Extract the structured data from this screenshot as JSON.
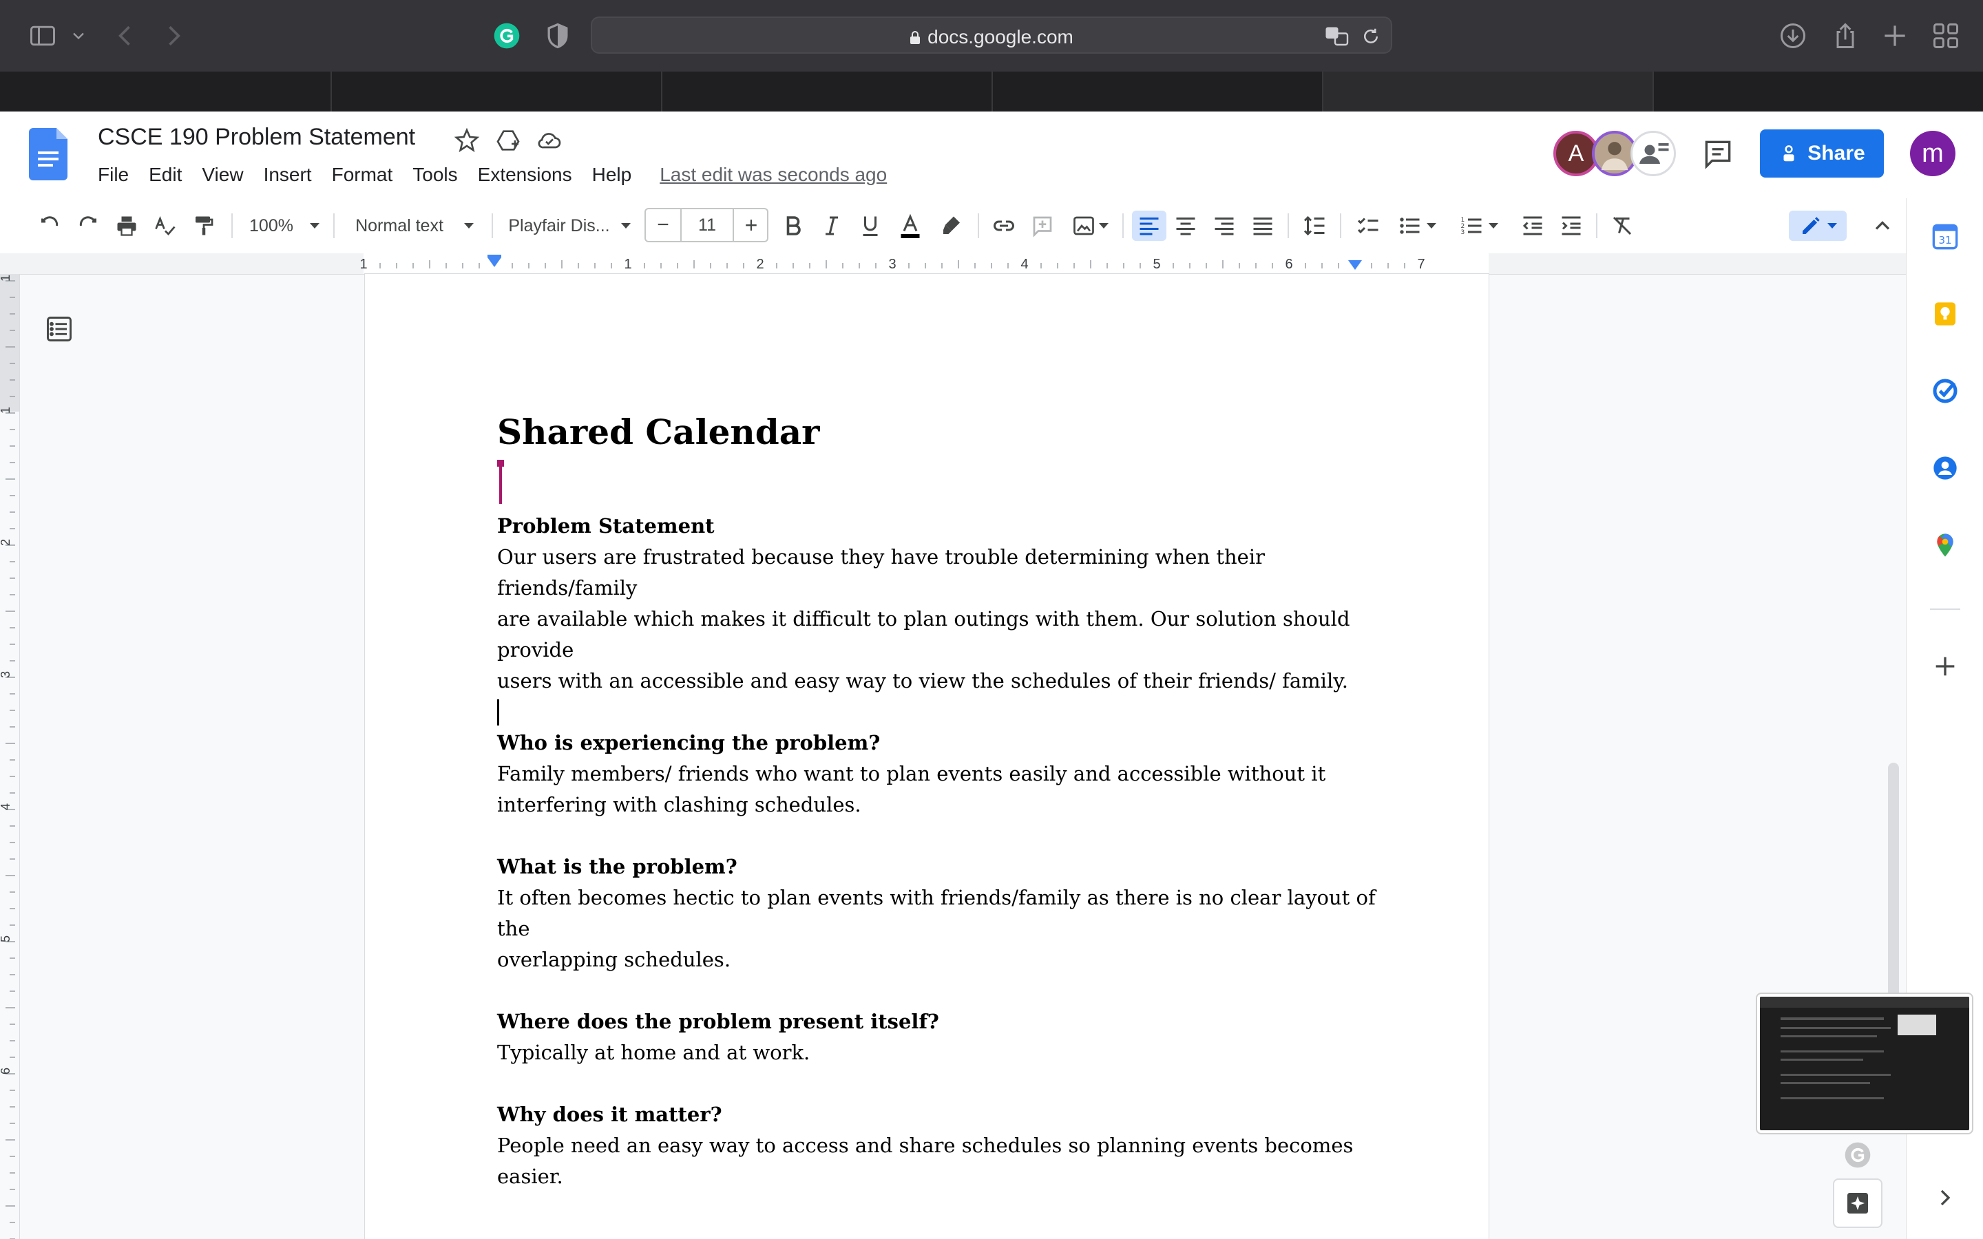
{
  "browser": {
    "url": "docs.google.com"
  },
  "doc": {
    "title": "CSCE 190 Problem Statement",
    "last_edit": "Last edit was seconds ago",
    "menu": [
      "File",
      "Edit",
      "View",
      "Insert",
      "Format",
      "Tools",
      "Extensions",
      "Help"
    ]
  },
  "header": {
    "share_label": "Share",
    "collaborator_initial": "A",
    "user_initial": "m"
  },
  "toolbar": {
    "zoom": "100%",
    "style": "Normal text",
    "font": "Playfair Dis...",
    "font_size": "11"
  },
  "ruler": {
    "labels": [
      "1",
      "1",
      "2",
      "3",
      "4",
      "5",
      "6",
      "7"
    ],
    "vlabels": [
      "1",
      "1",
      "2",
      "3",
      "4",
      "5",
      "6"
    ]
  },
  "content": {
    "heading": "Shared Calendar",
    "sections": [
      {
        "title": "Problem Statement",
        "lines": [
          "Our users are frustrated because they have trouble determining when their friends/family",
          "are available which makes it difficult to plan outings with them. Our solution should provide",
          "users with an accessible and easy way to view the schedules of their friends/ family."
        ]
      },
      {
        "title": "Who is experiencing the problem?",
        "lines": [
          "Family members/ friends who want to plan events easily and accessible without it",
          "interfering with clashing schedules."
        ]
      },
      {
        "title": "What is the problem?",
        "lines": [
          "It often becomes hectic to plan events with friends/family as there is no clear layout of the",
          "overlapping schedules."
        ]
      },
      {
        "title": "Where does the problem present itself?",
        "lines": [
          "Typically at home and at work."
        ]
      },
      {
        "title": "Why does it matter?",
        "lines": [
          "People need an easy way to access and share schedules so planning events becomes easier."
        ]
      }
    ]
  },
  "colors": {
    "share_blue": "#1a73e8",
    "user_avatar": "#7b1fa2",
    "collab_avatar": "#6d3030",
    "cursor_magenta": "#a8186a"
  }
}
